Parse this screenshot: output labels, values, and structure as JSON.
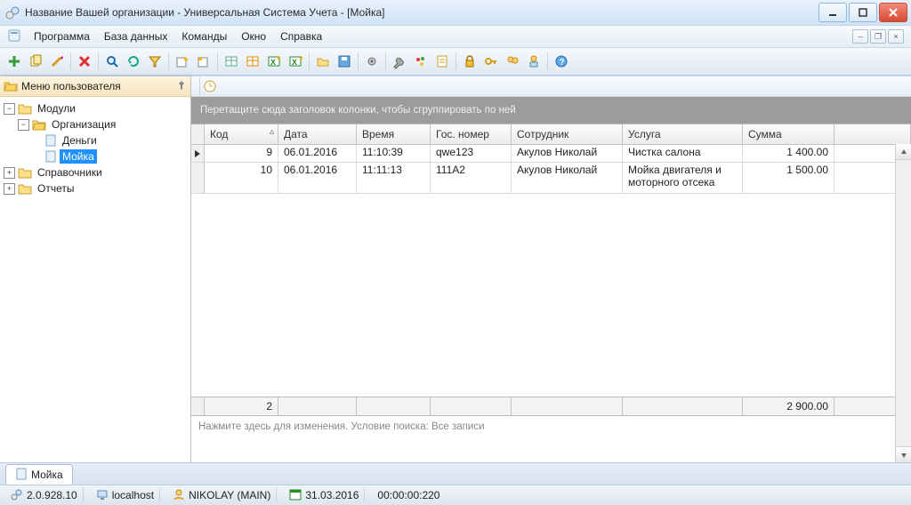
{
  "title": "Название Вашей организации - Универсальная Система Учета - [Мойка]",
  "menu": {
    "program": "Программа",
    "database": "База данных",
    "commands": "Команды",
    "window": "Окно",
    "help": "Справка"
  },
  "sidebar": {
    "title": "Меню пользователя",
    "items": [
      {
        "label": "Модули"
      },
      {
        "label": "Организация"
      },
      {
        "label": "Деньги"
      },
      {
        "label": "Мойка"
      },
      {
        "label": "Справочники"
      },
      {
        "label": "Отчеты"
      }
    ]
  },
  "grid": {
    "group_hint": "Перетащите сюда заголовок колонки, чтобы сгруппировать по ней",
    "columns": {
      "code": "Код",
      "date": "Дата",
      "time": "Время",
      "plate": "Гос. номер",
      "employee": "Сотрудник",
      "service": "Услуга",
      "sum": "Сумма"
    },
    "rows": [
      {
        "code": "9",
        "date": "06.01.2016",
        "time": "11:10:39",
        "plate": "qwe123",
        "employee": "Акулов Николай",
        "service": "Чистка салона",
        "sum": "1 400.00"
      },
      {
        "code": "10",
        "date": "06.01.2016",
        "time": "11:11:13",
        "plate": "111A2",
        "employee": "Акулов Николай",
        "service": "Мойка двигателя и моторного отсека",
        "sum": "1 500.00"
      }
    ],
    "footer": {
      "count": "2",
      "total": "2 900.00"
    },
    "filter_hint": "Нажмите здесь для изменения. Условие поиска: Все записи"
  },
  "tabs": {
    "doc": "Мойка"
  },
  "status": {
    "version": "2.0.928.10",
    "host": "localhost",
    "user": "NIKOLAY (MAIN)",
    "date": "31.03.2016",
    "timer": "00:00:00:220"
  }
}
